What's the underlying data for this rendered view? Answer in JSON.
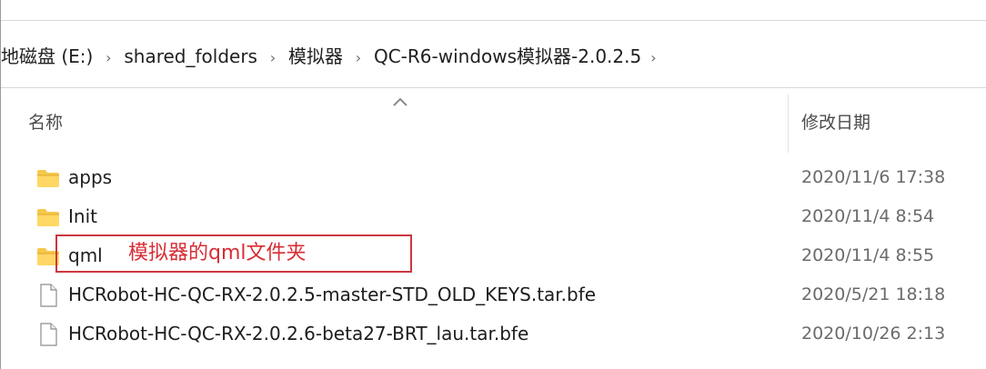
{
  "breadcrumb": {
    "items": [
      "地磁盘 (E:)",
      "shared_folders",
      "模拟器",
      "QC-R6-windows模拟器-2.0.2.5"
    ],
    "separator": "›"
  },
  "columns": {
    "name": "名称",
    "date": "修改日期"
  },
  "rows": [
    {
      "name": "apps",
      "date": "2020/11/6 17:38",
      "icon": "folder-icon"
    },
    {
      "name": "Init",
      "date": "2020/11/4 8:54",
      "icon": "folder-icon"
    },
    {
      "name": "qml",
      "date": "2020/11/4 8:55",
      "icon": "folder-icon"
    },
    {
      "name": "HCRobot-HC-QC-RX-2.0.2.5-master-STD_OLD_KEYS.tar.bfe",
      "date": "2020/5/21 18:18",
      "icon": "file-icon"
    },
    {
      "name": "HCRobot-HC-QC-RX-2.0.2.6-beta27-BRT_lau.tar.bfe",
      "date": "2020/10/26 2:13",
      "icon": "file-icon"
    }
  ],
  "annotation": {
    "text": "模拟器的qml文件夹",
    "color": "#d72d34"
  },
  "colors": {
    "folder": "#f5c84c",
    "folder_shade": "#e0a92a",
    "annotation_box": "#c9373f"
  }
}
